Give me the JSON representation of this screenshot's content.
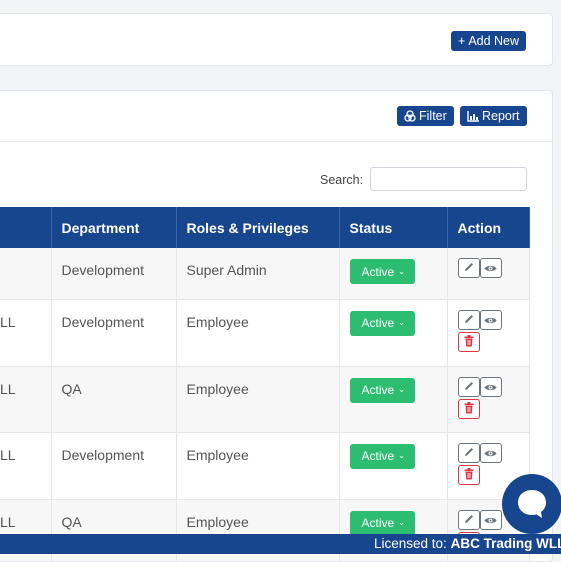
{
  "toolbar": {
    "add_new_label": "Add New",
    "filter_label": "Filter",
    "report_label": "Report"
  },
  "search": {
    "label": "Search:",
    "value": "",
    "placeholder": ""
  },
  "table": {
    "columns": [
      "",
      "Department",
      "Roles & Privileges",
      "Status",
      "Action"
    ],
    "rows": [
      {
        "name_fragment": "",
        "department": "Development",
        "role": "Super Admin",
        "status": "Active",
        "can_delete": false
      },
      {
        "name_fragment": "LL",
        "department": "Development",
        "role": "Employee",
        "status": "Active",
        "can_delete": true
      },
      {
        "name_fragment": "LL",
        "department": "QA",
        "role": "Employee",
        "status": "Active",
        "can_delete": true
      },
      {
        "name_fragment": "LL",
        "department": "Development",
        "role": "Employee",
        "status": "Active",
        "can_delete": true
      },
      {
        "name_fragment": "LL",
        "department": "QA",
        "role": "Employee",
        "status": "Active",
        "can_delete": true
      }
    ]
  },
  "footer": {
    "prefix": "Licensed to:",
    "company": "ABC Trading WLL"
  },
  "colors": {
    "primary": "#17468f",
    "active_green": "#2dbd70",
    "delete_red": "#dc3545"
  }
}
